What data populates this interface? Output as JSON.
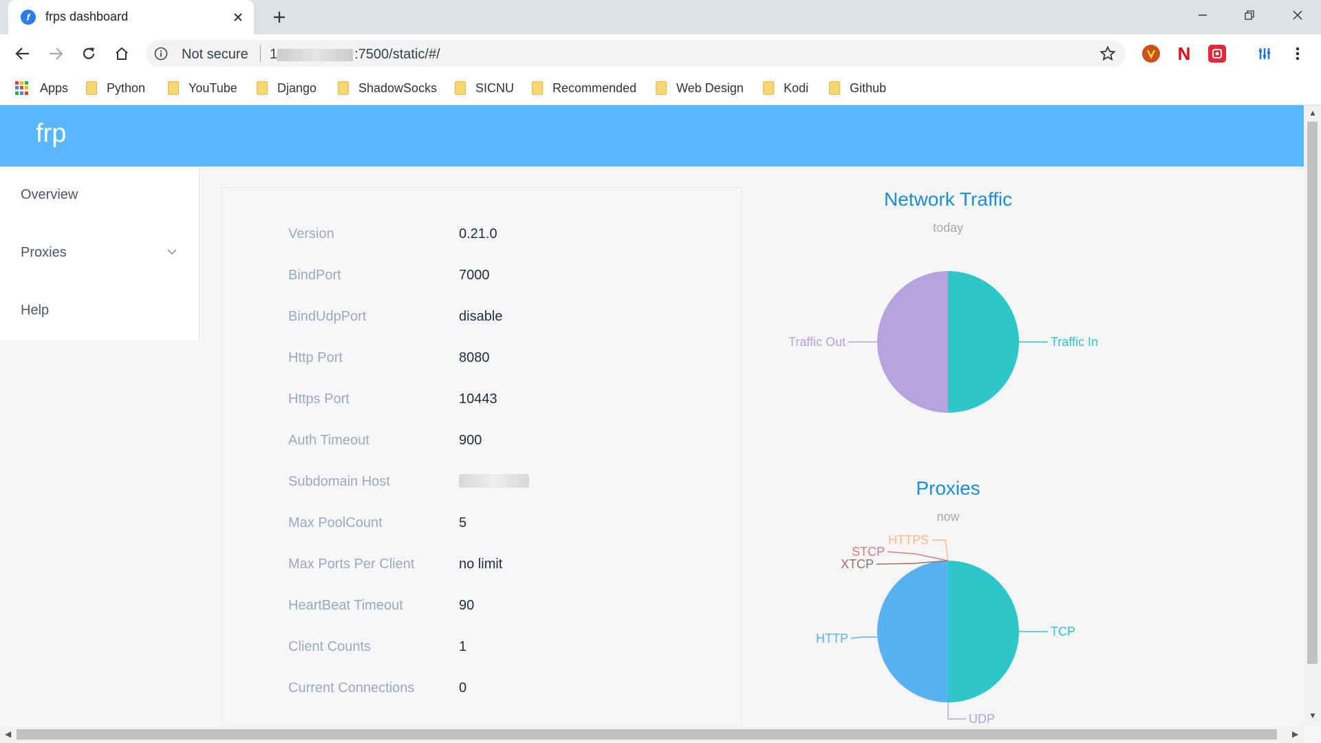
{
  "browser": {
    "tab_title": "frps dashboard",
    "favicon_letter": "f",
    "security_label": "Not secure",
    "url_prefix": "1",
    "url_suffix": ":7500/static/#/",
    "bookmarks": [
      "Apps",
      "Python",
      "YouTube",
      "Django",
      "ShadowSocks",
      "SICNU",
      "Recommended",
      "Web Design",
      "Kodi",
      "Github"
    ],
    "extensions": [
      "brave-icon",
      "netflix-icon",
      "red-extension-icon",
      "equalizer-icon"
    ],
    "extension_glyphs": [
      "",
      "N",
      "",
      ""
    ],
    "colors": {
      "tabstrip": "#dee1e6",
      "omnibox": "#f1f3f4",
      "folder": "#f7d775"
    }
  },
  "header": {
    "brand": "frp",
    "color": "#58b7ff"
  },
  "sidebar": {
    "items": [
      "Overview",
      "Proxies",
      "Help"
    ]
  },
  "server_info": [
    {
      "label": "Version",
      "value": "0.21.0"
    },
    {
      "label": "BindPort",
      "value": "7000"
    },
    {
      "label": "BindUdpPort",
      "value": "disable"
    },
    {
      "label": "Http Port",
      "value": "8080"
    },
    {
      "label": "Https Port",
      "value": "10443"
    },
    {
      "label": "Auth Timeout",
      "value": "900"
    },
    {
      "label": "Subdomain Host",
      "value": ""
    },
    {
      "label": "Max PoolCount",
      "value": "5"
    },
    {
      "label": "Max Ports Per Client",
      "value": "no limit"
    },
    {
      "label": "HeartBeat Timeout",
      "value": "90"
    },
    {
      "label": "Client Counts",
      "value": "1"
    },
    {
      "label": "Current Connections",
      "value": "0"
    }
  ],
  "chart_data": [
    {
      "type": "pie",
      "title": "Network Traffic",
      "subtitle": "today",
      "categories": [
        "Traffic In",
        "Traffic Out"
      ],
      "values": [
        50,
        50
      ],
      "colors": [
        "#2ec7c9",
        "#b6a2de"
      ]
    },
    {
      "type": "pie",
      "title": "Proxies",
      "subtitle": "now",
      "categories": [
        "TCP",
        "UDP",
        "HTTP",
        "XTCP",
        "STCP",
        "HTTPS"
      ],
      "values": [
        50,
        0,
        50,
        0,
        0,
        0
      ],
      "colors": [
        "#2ec7c9",
        "#b6a2de",
        "#5ab1ef",
        "#95706d",
        "#d87a80",
        "#ffb980"
      ]
    }
  ]
}
